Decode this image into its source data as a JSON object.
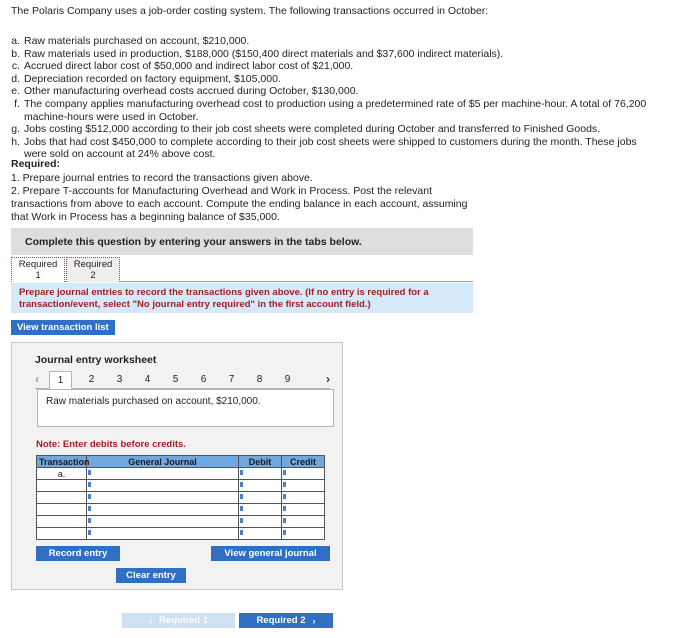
{
  "intro": "The Polaris Company uses a job-order costing system. The following transactions occurred in October:",
  "transactions": [
    {
      "letter": "a.",
      "text": "Raw materials purchased on account, $210,000."
    },
    {
      "letter": "b.",
      "text": "Raw materials used in production, $188,000 ($150,400 direct materials and $37,600 indirect materials)."
    },
    {
      "letter": "c.",
      "text": "Accrued direct labor cost of $50,000 and indirect labor cost of $21,000."
    },
    {
      "letter": "d.",
      "text": "Depreciation recorded on factory equipment, $105,000."
    },
    {
      "letter": "e.",
      "text": "Other manufacturing overhead costs accrued during October, $130,000."
    },
    {
      "letter": "f.",
      "text": "The company applies manufacturing overhead cost to production using a predetermined rate of $5 per machine-hour. A total of 76,200 machine-hours were used in October."
    },
    {
      "letter": "g.",
      "text": "Jobs costing $512,000 according to their job cost sheets were completed during October and transferred to Finished Goods."
    },
    {
      "letter": "h.",
      "text": "Jobs that had cost $450,000 to complete according to their job cost sheets were shipped to customers during the month. These jobs were sold on account at 24% above cost."
    }
  ],
  "required": {
    "title": "Required:",
    "line1": "1. Prepare journal entries to record the transactions given above.",
    "line2": "2. Prepare T-accounts for Manufacturing Overhead and Work in Process. Post the relevant transactions from above to each account. Compute the ending balance in each account, assuming that Work in Process has a beginning balance of $35,000."
  },
  "banner": {
    "text": "Complete this question by entering your answers in the tabs below."
  },
  "tabs": [
    {
      "line1": "Required",
      "line2": "1",
      "active": true
    },
    {
      "line1": "Required",
      "line2": "2",
      "active": false
    }
  ],
  "instruction": {
    "text": "Prepare journal entries to record the transactions given above. (If no entry is required for a transaction/event, select \"No journal entry required\" in the first account field.)"
  },
  "buttons": {
    "view_transaction_list": "View transaction list",
    "record_entry": "Record entry",
    "view_general_journal": "View general journal",
    "clear_entry": "Clear entry"
  },
  "worksheet": {
    "title": "Journal entry worksheet",
    "prev_arrow": "‹",
    "next_arrow": "›",
    "pages": [
      "1",
      "2",
      "3",
      "4",
      "5",
      "6",
      "7",
      "8",
      "9"
    ],
    "active_page": "1",
    "description": "Raw materials purchased on account, $210,000.",
    "note": "Note: Enter debits before credits.",
    "table": {
      "headers": [
        "Transaction",
        "General Journal",
        "Debit",
        "Credit"
      ],
      "rows": [
        {
          "transaction": "a.",
          "general_journal": "",
          "debit": "",
          "credit": ""
        },
        {
          "transaction": "",
          "general_journal": "",
          "debit": "",
          "credit": ""
        },
        {
          "transaction": "",
          "general_journal": "",
          "debit": "",
          "credit": ""
        },
        {
          "transaction": "",
          "general_journal": "",
          "debit": "",
          "credit": ""
        },
        {
          "transaction": "",
          "general_journal": "",
          "debit": "",
          "credit": ""
        },
        {
          "transaction": "",
          "general_journal": "",
          "debit": "",
          "credit": ""
        }
      ]
    }
  },
  "bottom_nav": {
    "prev_label": "Required 1",
    "prev_chevron": "‹",
    "next_label": "Required 2",
    "next_chevron": "›"
  },
  "colors": {
    "accent_blue": "#2f6fc4",
    "table_header_blue": "#6fa8e0",
    "instruction_bg": "#d4eafa",
    "instruction_text": "#a32020",
    "banner_bg": "#dededf",
    "panel_bg": "#f2f2f2",
    "nav_disabled": "#cfe0f3"
  }
}
